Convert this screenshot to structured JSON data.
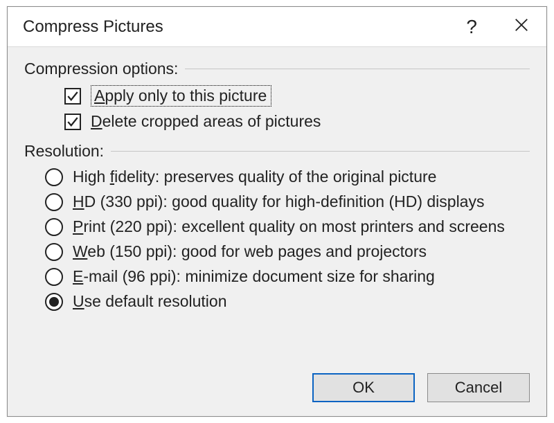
{
  "title": "Compress Pictures",
  "help_symbol": "?",
  "groups": {
    "compression": {
      "label": "Compression options:",
      "apply_only": {
        "pre": "",
        "ul": "A",
        "post": "pply only to this picture",
        "checked": true,
        "focused": true
      },
      "delete_cropped": {
        "pre": "",
        "ul": "D",
        "post": "elete cropped areas of pictures",
        "checked": true,
        "focused": false
      }
    },
    "resolution": {
      "label": "Resolution:",
      "options": [
        {
          "id": "high-fidelity",
          "pre": "High ",
          "ul": "f",
          "post": "idelity: preserves quality of the original picture",
          "selected": false
        },
        {
          "id": "hd-330",
          "pre": "",
          "ul": "H",
          "post": "D (330 ppi): good quality for high-definition (HD) displays",
          "selected": false
        },
        {
          "id": "print-220",
          "pre": "",
          "ul": "P",
          "post": "rint (220 ppi): excellent quality on most printers and screens",
          "selected": false
        },
        {
          "id": "web-150",
          "pre": "",
          "ul": "W",
          "post": "eb (150 ppi): good for web pages and projectors",
          "selected": false
        },
        {
          "id": "email-96",
          "pre": "",
          "ul": "E",
          "post": "-mail (96 ppi): minimize document size for sharing",
          "selected": false
        },
        {
          "id": "default",
          "pre": "",
          "ul": "U",
          "post": "se default resolution",
          "selected": true
        }
      ]
    }
  },
  "buttons": {
    "ok": "OK",
    "cancel": "Cancel"
  }
}
